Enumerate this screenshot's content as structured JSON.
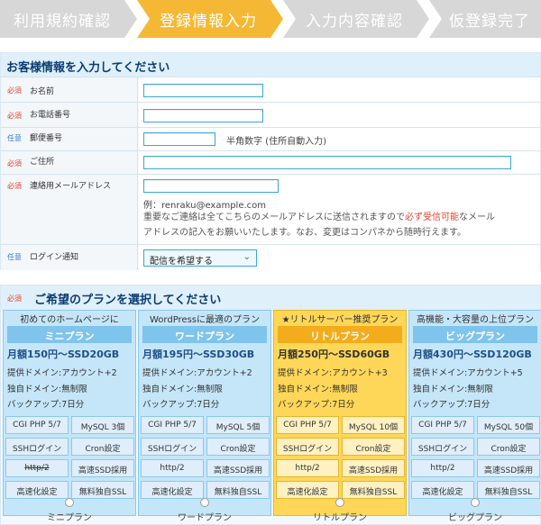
{
  "steps": [
    {
      "label": "利用規約確認",
      "state": "inactive"
    },
    {
      "label": "登録情報入力",
      "state": "active"
    },
    {
      "label": "入力内容確認",
      "state": "inactive"
    },
    {
      "label": "仮登録完了",
      "state": "inactive"
    }
  ],
  "customer": {
    "title": "お客様情報を入力してください",
    "required_tag": "必須",
    "optional_tag": "任意",
    "name_label": "お名前",
    "phone_label": "お電話番号",
    "zip_label": "郵便番号",
    "zip_hint": "半角数字 (住所自動入力)",
    "address_label": "ご住所",
    "email_label": "連絡用メールアドレス",
    "email_example": "例：renraku@example.com",
    "email_note_1": "重要なご連絡は全てこちらのメールアドレスに送信されますので",
    "email_note_red": "必ず受信可能",
    "email_note_2": "なメール",
    "email_note_3": "アドレスの記入をお願いいたします。なお、変更はコンパネから随時行えます。",
    "login_notice_label": "ログイン通知",
    "login_notice_value": "配信を希望する"
  },
  "plans_section": {
    "required_tag": "必須",
    "title": "ご希望のプランを選択してください"
  },
  "plans": [
    {
      "caption": "初めてのホームページに",
      "name": "ミニプラン",
      "price": "月額150円～SSD20GB",
      "domains": "提供ドメイン:アカウント+2",
      "own_domain": "独自ドメイン:無制限",
      "backup": "バックアップ:7日分",
      "features": [
        "CGI PHP 5/7",
        "MySQL 3個",
        "SSHログイン",
        "Cron設定",
        "http/2",
        "高速SSD採用",
        "高速化設定",
        "無料独自SSL"
      ],
      "strike_index": 4,
      "radio_label": "ミニプラン",
      "featured": false
    },
    {
      "caption": "WordPressに最適のプラン",
      "name": "ワードプラン",
      "price": "月額195円～SSD30GB",
      "domains": "提供ドメイン:アカウント+2",
      "own_domain": "独自ドメイン:無制限",
      "backup": "バックアップ:7日分",
      "features": [
        "CGI PHP 5/7",
        "MySQL 5個",
        "SSHログイン",
        "Cron設定",
        "http/2",
        "高速SSD採用",
        "高速化設定",
        "無料独自SSL"
      ],
      "strike_index": -1,
      "radio_label": "ワードプラン",
      "featured": false
    },
    {
      "caption": "★リトルサーバー推奨プラン",
      "name": "リトルプラン",
      "price": "月額250円～SSD60GB",
      "domains": "提供ドメイン:アカウント+3",
      "own_domain": "独自ドメイン:無制限",
      "backup": "バックアップ:7日分",
      "features": [
        "CGI PHP 5/7",
        "MySQL 10個",
        "SSHログイン",
        "Cron設定",
        "http/2",
        "高速SSD採用",
        "高速化設定",
        "無料独自SSL"
      ],
      "strike_index": -1,
      "radio_label": "リトルプラン",
      "featured": true
    },
    {
      "caption": "高機能・大容量の上位プラン",
      "name": "ビッグプラン",
      "price": "月額430円～SSD120GB",
      "domains": "提供ドメイン:アカウント+5",
      "own_domain": "独自ドメイン:無制限",
      "backup": "バックアップ:7日分",
      "features": [
        "CGI PHP 5/7",
        "MySQL 50個",
        "SSHログイン",
        "Cron設定",
        "http/2",
        "高速SSD採用",
        "高速化設定",
        "無料独自SSL"
      ],
      "strike_index": -1,
      "radio_label": "ビッグプラン",
      "featured": false
    }
  ],
  "colors": {
    "step_active": "#f5b834",
    "step_inactive": "#d7d7d7",
    "required": "#e0432e",
    "optional": "#3b78c2",
    "plan_blue": "#c5e6f8",
    "plan_featured": "#ffd758"
  }
}
